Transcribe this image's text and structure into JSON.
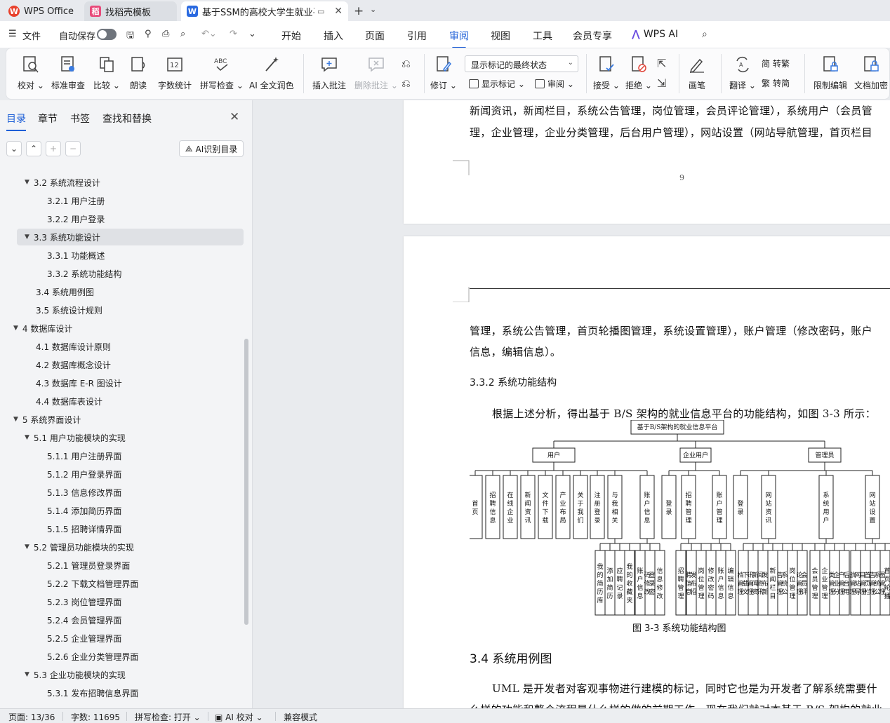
{
  "titlebar": {
    "tabs": [
      {
        "label": "WPS Office"
      },
      {
        "label": "找稻壳模板"
      },
      {
        "label": "基于SSM的高校大学生就业平"
      }
    ]
  },
  "menubar": {
    "file": "文件",
    "autosave": "自动保存",
    "tabs": [
      "开始",
      "插入",
      "页面",
      "引用",
      "审阅",
      "视图",
      "工具",
      "会员专享"
    ],
    "wps_ai": "WPS AI"
  },
  "ribbon": {
    "proofread": "校对",
    "standard_review": "标准审查",
    "compare": "比较",
    "read_aloud": "朗读",
    "word_count": "字数统计",
    "spell_check": "拼写检查",
    "ai_polish": "AI 全文润色",
    "insert_comment": "插入批注",
    "delete_comment": "删除批注",
    "track_changes": "修订",
    "display_mode": "显示标记的最终状态",
    "show_markup": "显示标记",
    "review": "审阅",
    "accept": "接受",
    "reject": "拒绝",
    "pen": "画笔",
    "translate": "翻译",
    "to_traditional": "转繁",
    "to_simplified": "转简",
    "restrict_edit": "限制编辑",
    "encrypt": "文档加密"
  },
  "sidebar": {
    "tabs": [
      "目录",
      "章节",
      "书签",
      "查找和替换"
    ],
    "ai_toc": "AI识别目录",
    "toc": [
      {
        "label": "3.2 系统流程设计"
      },
      {
        "label": "3.2.1  用户注册"
      },
      {
        "label": "3.2.2  用户登录"
      },
      {
        "label": "3.3 系统功能设计"
      },
      {
        "label": "3.3.1  功能概述"
      },
      {
        "label": "3.3.2  系统功能结构"
      },
      {
        "label": "3.4 系统用例图"
      },
      {
        "label": "3.5 系统设计规则"
      },
      {
        "label": "4 数据库设计"
      },
      {
        "label": "4.1 数据库设计原则"
      },
      {
        "label": "4.2 数据库概念设计"
      },
      {
        "label": "4.3 数据库 E-R 图设计"
      },
      {
        "label": "4.4 数据库表设计"
      },
      {
        "label": "5 系统界面设计"
      },
      {
        "label": "5.1 用户功能模块的实现"
      },
      {
        "label": "5.1.1  用户注册界面"
      },
      {
        "label": "5.1.2 用户登录界面"
      },
      {
        "label": "5.1.3 信息修改界面"
      },
      {
        "label": "5.1.4 添加简历界面"
      },
      {
        "label": "5.1.5 招聘详情界面"
      },
      {
        "label": "5.2 管理员功能模块的实现"
      },
      {
        "label": "5.2.1 管理员登录界面"
      },
      {
        "label": "5.2.2 下载文档管理界面"
      },
      {
        "label": "5.2.3 岗位管理界面"
      },
      {
        "label": "5.2.4 会员管理界面"
      },
      {
        "label": "5.2.5 企业管理界面"
      },
      {
        "label": "5.2.6 企业分类管理界面"
      },
      {
        "label": "5.3 企业功能模块的实现"
      },
      {
        "label": "5.3.1 发布招聘信息界面"
      }
    ]
  },
  "document": {
    "page1_line1": "新闻资讯，新闻栏目，系统公告管理，岗位管理，会员评论管理），系统用户（会员管",
    "page1_line2": "理，企业管理，企业分类管理，后台用户管理），网站设置（网站导航管理，首页栏目",
    "page_number": "9",
    "page2_line1": "管理，系统公告管理，首页轮播图管理，系统设置管理），账户管理（修改密码，账户",
    "page2_line2": "信息，编辑信息）。",
    "heading_332": "3.3.2  系统功能结构",
    "para_intro": "根据上述分析，得出基于 B/S 架构的就业信息平台的功能结构，如图 3-3 所示：",
    "figure": {
      "root": "基于B/S架构的就业信息平台",
      "groups": [
        "用户",
        "企业用户",
        "管理员"
      ],
      "user_nodes": [
        "首页",
        "招聘信息",
        "在线企业",
        "新闻资讯",
        "文件下载",
        "产业布局",
        "关于我们",
        "注册登录",
        "与我相关",
        "账户信息"
      ],
      "user_sub": [
        "我的简历库",
        "添加简历",
        "应聘记录",
        "我的收藏夹",
        "账户信息",
        "登录密码修改",
        "信息修改"
      ],
      "company_nodes": [
        "登录",
        "招聘管理",
        "账户管理"
      ],
      "company_sub": [
        "招聘管理",
        "发布招聘信息",
        "岗位管理",
        "修改密码",
        "账户信息",
        "编辑信息"
      ],
      "admin_nodes": [
        "登录",
        "网站资讯",
        "系统用户",
        "网站设置"
      ],
      "admin_sub": [
        "下载文档管理",
        "新闻资讯管理",
        "发布新闻资讯",
        "新闻栏目",
        "系统公告管理",
        "岗位管理",
        "会员评论管理",
        "会员管理",
        "企业管理",
        "企业分类管理",
        "后台用户管理",
        "网站导航管理",
        "首页栏目管理",
        "系统公告管理",
        "首页轮播图管理"
      ]
    },
    "figure_caption": "图 3-3  系统功能结构图",
    "heading_34": "3.4 系统用例图",
    "para_uml": "UML 是开发者对客观事物进行建模的标记，同时它也是为开发者了解系统需要什",
    "para_uml2": "么样的功能和整个流程是什么样的做的前期工作，现在我们就对本基于 B/S 架构的就业"
  },
  "statusbar": {
    "page": "页面: 13/36",
    "words": "字数: 11695",
    "spell": "拼写检查: 打开",
    "ai_proof": "AI 校对",
    "compat": "兼容模式"
  },
  "colors": {
    "accent": "#1e5fd7",
    "wps_red": "#e8412c"
  }
}
